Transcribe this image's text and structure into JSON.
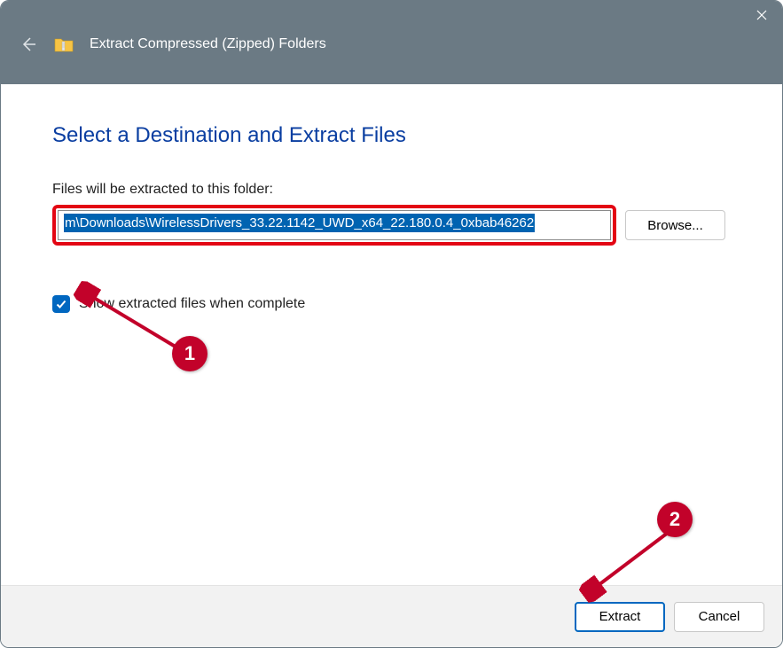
{
  "titlebar": {
    "title": "Extract Compressed (Zipped) Folders"
  },
  "main": {
    "heading": "Select a Destination and Extract Files",
    "path_label": "Files will be extracted to this folder:",
    "path_value": "m\\Downloads\\WirelessDrivers_33.22.1142_UWD_x64_22.180.0.4_0xbab46262",
    "browse_label": "Browse...",
    "checkbox_label": "Show extracted files when complete",
    "checkbox_checked": true
  },
  "footer": {
    "extract_label": "Extract",
    "cancel_label": "Cancel"
  },
  "annotations": {
    "badge1": "1",
    "badge2": "2",
    "colors": {
      "accent": "#c2022a"
    }
  }
}
